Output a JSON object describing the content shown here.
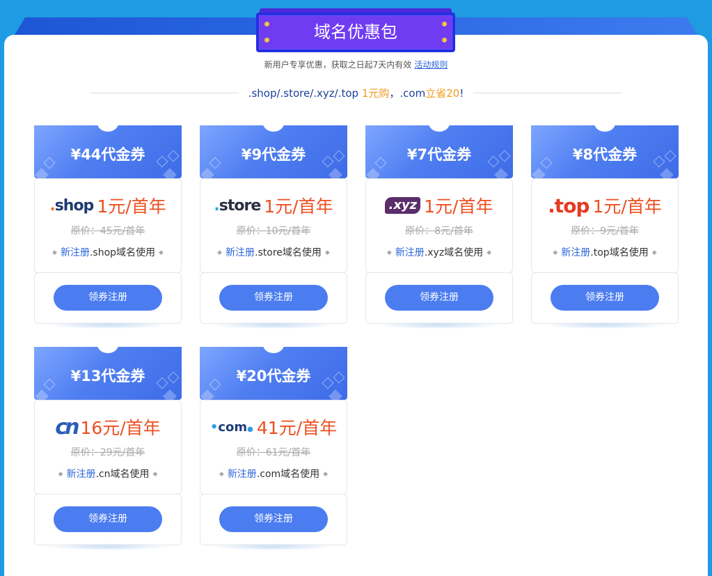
{
  "header": {
    "title": "域名优惠包",
    "subtitle": "新用户专享优惠，获取之日起7天内有效",
    "rules_link": "活动规则",
    "headline_part1": ".shop/.store/.xyz/.top",
    "headline_part2": "1元购",
    "headline_part3": "，.com",
    "headline_part4": "立省20",
    "headline_part5": "!"
  },
  "colors": {
    "page_bg": "#1e9be2",
    "accent_blue": "#4b7df0",
    "price_orange": "#ec4f20",
    "badge_purple": "#6f3cf2"
  },
  "cards": [
    {
      "voucher": "¥44代金券",
      "logo_text": "shop",
      "price": "1元/首年",
      "original": "原价：45元/首年",
      "note_prefix": "新注册",
      "note_suffix": ".shop域名使用",
      "button": "领券注册"
    },
    {
      "voucher": "¥9代金券",
      "logo_text": "store",
      "price": "1元/首年",
      "original": "原价：10元/首年",
      "note_prefix": "新注册",
      "note_suffix": ".store域名使用",
      "button": "领券注册"
    },
    {
      "voucher": "¥7代金券",
      "logo_text": ".xyz",
      "price": "1元/首年",
      "original": "原价：8元/首年",
      "note_prefix": "新注册",
      "note_suffix": ".xyz域名使用",
      "button": "领券注册"
    },
    {
      "voucher": "¥8代金券",
      "logo_text": ".top",
      "price": "1元/首年",
      "original": "原价：9元/首年",
      "note_prefix": "新注册",
      "note_suffix": ".top域名使用",
      "button": "领券注册"
    },
    {
      "voucher": "¥13代金券",
      "logo_text": "cn",
      "price": "16元/首年",
      "original": "原价：29元/首年",
      "note_prefix": "新注册",
      "note_suffix": ".cn域名使用",
      "button": "领券注册"
    },
    {
      "voucher": "¥20代金券",
      "logo_text": "com",
      "price": "41元/首年",
      "original": "原价：61元/首年",
      "note_prefix": "新注册",
      "note_suffix": ".com域名使用",
      "button": "领券注册"
    }
  ]
}
